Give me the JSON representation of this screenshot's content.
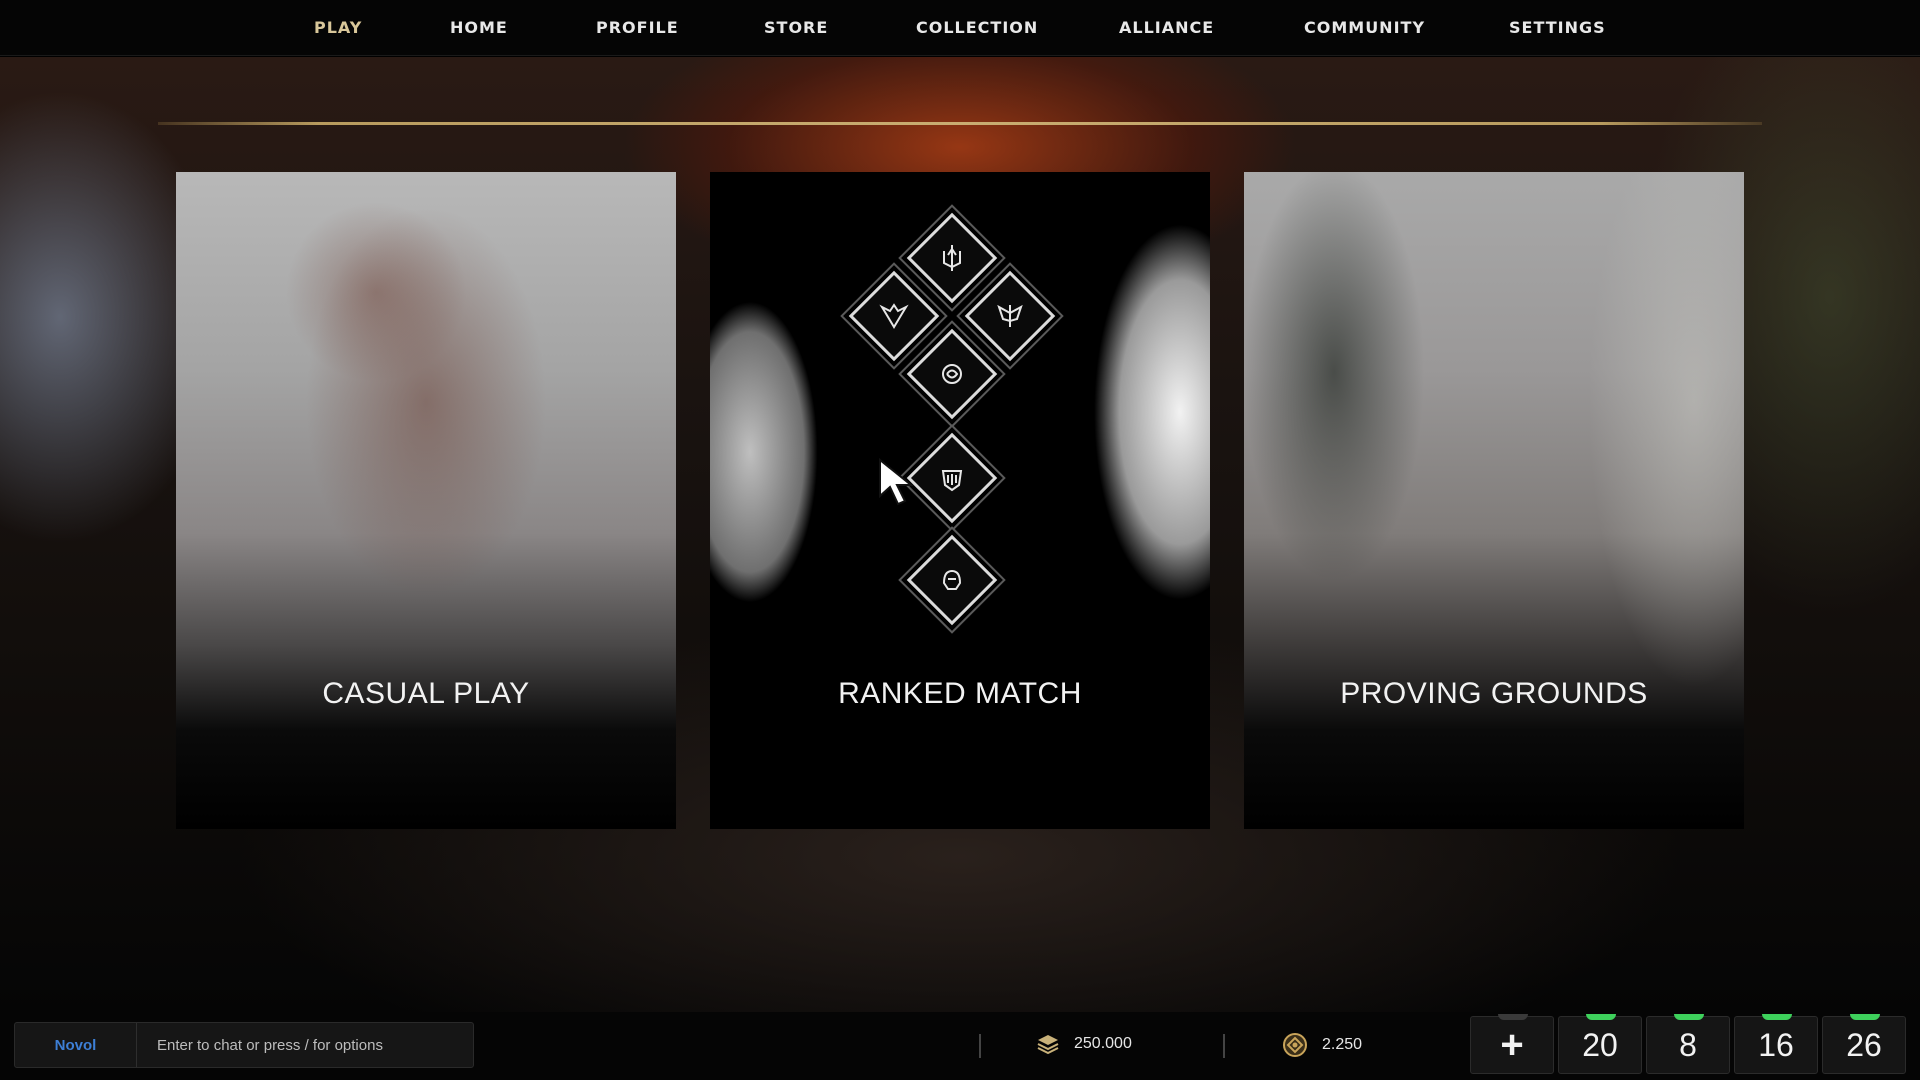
{
  "nav": {
    "items": [
      {
        "label": "PLAY",
        "active": true
      },
      {
        "label": "HOME",
        "active": false
      },
      {
        "label": "PROFILE",
        "active": false
      },
      {
        "label": "STORE",
        "active": false
      },
      {
        "label": "COLLECTION",
        "active": false
      },
      {
        "label": "ALLIANCE",
        "active": false
      },
      {
        "label": "COMMUNITY",
        "active": false
      },
      {
        "label": "SETTINGS",
        "active": false
      }
    ]
  },
  "modes": {
    "casual": {
      "label": "CASUAL PLAY"
    },
    "ranked": {
      "label": "RANKED MATCH"
    },
    "proving": {
      "label": "PROVING GROUNDS"
    }
  },
  "chat": {
    "channel": "Novol",
    "placeholder": "Enter to chat or press / for options"
  },
  "currency": {
    "primary": {
      "icon": "layers-icon",
      "value": "250.000"
    },
    "secondary": {
      "icon": "coin-icon",
      "value": "2.250"
    }
  },
  "stats": {
    "add_icon": "+",
    "counters": [
      "20",
      "8",
      "16",
      "26"
    ]
  },
  "colors": {
    "active_nav": "#d9c79a",
    "gold_line": "#c9ad72",
    "chat_channel": "#3d7fd6",
    "stat_indicator": "#3ed15c"
  }
}
